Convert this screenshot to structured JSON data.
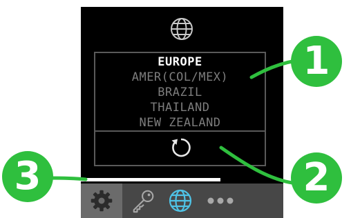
{
  "regions": [
    "EUROPE",
    "AMER(COL/MEX)",
    "BRAZIL",
    "THAILAND",
    "NEW ZEALAND"
  ],
  "selected_region": "EUROPE",
  "progress_fraction": 0.69,
  "icons": {
    "header": "globe-icon",
    "reset": "reset-icon",
    "tabs": [
      "gear-icon",
      "key-icon",
      "globe-icon",
      "more-icon"
    ]
  },
  "callouts": [
    "1",
    "2",
    "3"
  ],
  "colors": {
    "screen_bg": "#000000",
    "selected_text": "#ffffff",
    "unselected_text": "#7d7d7d",
    "tabbar_bg": "#474747",
    "active_tab_bg": "#6b6b6b",
    "active_icon": "#4fc3e6",
    "callout": "#2fbf3e"
  }
}
